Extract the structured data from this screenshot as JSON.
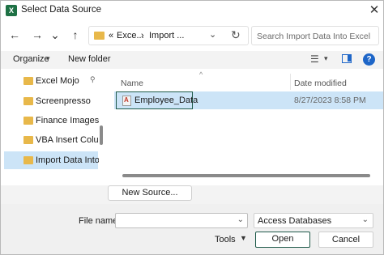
{
  "window": {
    "title": "Select Data Source",
    "app_icon": "excel-icon",
    "close_glyph": "✕"
  },
  "nav": {
    "back_glyph": "←",
    "forward_glyph": "→",
    "recent_glyph": "⌄",
    "up_glyph": "↑",
    "address": {
      "overflow": "«",
      "segments": [
        "Exce...",
        "›",
        "Import ..."
      ],
      "dropdown_glyph": "⌄",
      "refresh_glyph": "↻"
    },
    "search": {
      "placeholder": "Search Import Data Into Excel"
    }
  },
  "toolbar": {
    "organize": "Organize",
    "organize_caret": "▾",
    "new_folder": "New folder",
    "view_glyph": "☰",
    "view_caret": "▾",
    "help_glyph": "?"
  },
  "sidebar": {
    "items": [
      {
        "label": "Excel Mojo",
        "pinned": true,
        "selected": false
      },
      {
        "label": "Screenpresso",
        "selected": false
      },
      {
        "label": "Finance Images",
        "selected": false
      },
      {
        "label": "VBA Insert Columns",
        "selected": false
      },
      {
        "label": "Import Data Into Excel",
        "selected": true
      }
    ],
    "pin_glyph": "📌"
  },
  "files": {
    "columns": {
      "name": "Name",
      "date": "Date modified",
      "sort_glyph": "^"
    },
    "rows": [
      {
        "name": "Employee_Data",
        "date": "8/27/2023 8:58 PM",
        "icon": "access-file-icon",
        "selected": true
      }
    ]
  },
  "new_source": "New Source...",
  "bottom": {
    "file_name_label": "File name:",
    "file_name_value": "",
    "file_name_caret": "⌄",
    "file_type": "Access Databases",
    "file_type_caret": "⌄",
    "tools": "Tools",
    "tools_caret": "▼",
    "open": "Open",
    "cancel": "Cancel"
  },
  "colors": {
    "selection": "#cce4f7",
    "folder": "#e8b84a",
    "accent": "#1e66c8",
    "focus_border": "#1f5a4a",
    "excel_green": "#1e7145"
  }
}
